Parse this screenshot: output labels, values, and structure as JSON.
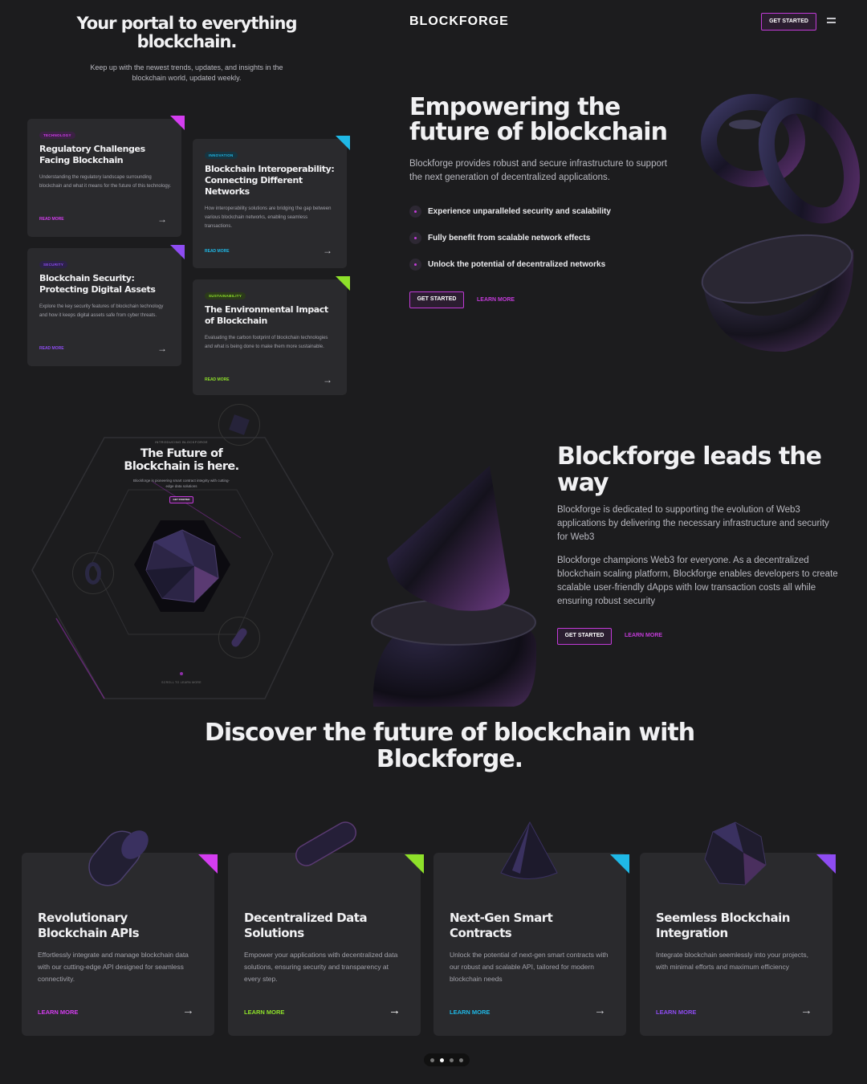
{
  "hero": {
    "title": "Your portal to everything blockchain.",
    "subtitle": "Keep up with the newest trends, updates, and insights in the blockchain world, updated weekly."
  },
  "articles": [
    {
      "tag": "TECHNOLOGY",
      "title": "Regulatory Challenges Facing Blockchain",
      "desc": "Understanding the regulatory landscape surrounding blockchain and what it means for the future of this technology.",
      "link": "READ MORE",
      "color": "#d43df0"
    },
    {
      "tag": "INNOVATION",
      "title": "Blockchain Interoperability: Connecting Different Networks",
      "desc": "How interoperability solutions are bridging the gap between various blockchain networks, enabling seamless transactions.",
      "link": "READ MORE",
      "color": "#1fb8e6"
    },
    {
      "tag": "SECURITY",
      "title": "Blockchain Security: Protecting Digital Assets",
      "desc": "Explore the key security features of blockchain technology and how it keeps digital assets safe from cyber threats.",
      "link": "READ MORE",
      "color": "#8e4cf2"
    },
    {
      "tag": "SUSTAINABILITY",
      "title": "The Environmental Impact of Blockchain",
      "desc": "Evaluating the carbon footprint of blockchain technologies and what is being done to make them more sustainable.",
      "link": "READ MORE",
      "color": "#8ee02a"
    }
  ],
  "nav": {
    "brand": "BLOCKFORGE",
    "cta": "GET STARTED"
  },
  "empower": {
    "title": "Empowering the future of blockchain",
    "desc": "Blockforge provides robust and secure infrastructure to support the next generation of decentralized applications.",
    "bullets": [
      "Experience unparalleled security and scalability",
      "Fully benefit from scalable network effects",
      "Unlock the potential of decentralized networks"
    ],
    "cta": "GET STARTED",
    "link": "LEARN MORE"
  },
  "intro": {
    "eyebrow": "INTRODUCING BLOCKFORGE",
    "title": "The Future of Blockchain is here.",
    "desc": "Blockforge is pioneering smart contract integrity with cutting-edge data solutions",
    "cta": "GET STARTED",
    "scroll": "SCROLL TO LEARN MORE"
  },
  "lead": {
    "title": "Blockforge leads the way",
    "p1": "Blockforge is dedicated to supporting the evolution of Web3 applications by delivering the necessary infrastructure and security for Web3",
    "p2": "Blockforge champions Web3 for everyone. As a decentralized blockchain scaling platform, Blockforge enables developers to create scalable user-friendly dApps with low transaction costs all while ensuring robust security",
    "cta": "GET STARTED",
    "link": "LEARN MORE"
  },
  "discover": {
    "title": "Discover the future of blockchain with Blockforge."
  },
  "features": [
    {
      "title": "Revolutionary Blockchain APIs",
      "desc": "Effortlessly integrate and manage blockchain data with our cutting-edge API designed for seamless connectivity.",
      "link": "LEARN MORE",
      "color": "#d43df0"
    },
    {
      "title": "Decentralized Data Solutions",
      "desc": "Empower your applications with decentralized data solutions, ensuring security and transparency at every step.",
      "link": "LEARN MORE",
      "color": "#8ee02a"
    },
    {
      "title": "Next-Gen Smart Contracts",
      "desc": "Unlock the potential of next-gen smart contracts with our robust and scalable API, tailored for modern blockchain needs",
      "link": "LEARN MORE",
      "color": "#1fb8e6"
    },
    {
      "title": "Seemless Blockchain Integration",
      "desc": "Integrate blockchain seemlessly into your projects, with minimal efforts and maximum efficiency",
      "link": "LEARN MORE",
      "color": "#8e4cf2"
    }
  ],
  "carousel": {
    "active_index": 1,
    "total": 4
  }
}
